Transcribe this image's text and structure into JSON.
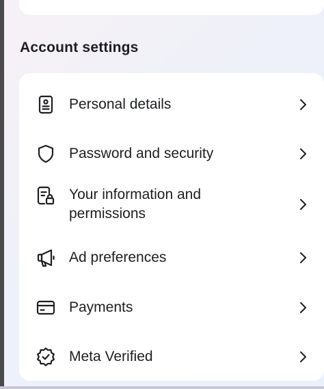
{
  "section": {
    "title": "Account settings"
  },
  "items": [
    {
      "label": "Personal details",
      "icon": "id-card-icon"
    },
    {
      "label": "Password and security",
      "icon": "shield-icon"
    },
    {
      "label": "Your information and permissions",
      "icon": "document-lock-icon"
    },
    {
      "label": "Ad preferences",
      "icon": "megaphone-icon"
    },
    {
      "label": "Payments",
      "icon": "credit-card-icon"
    },
    {
      "label": "Meta Verified",
      "icon": "verified-badge-icon"
    }
  ],
  "colors": {
    "text": "#1c1e21",
    "card": "#ffffff"
  }
}
